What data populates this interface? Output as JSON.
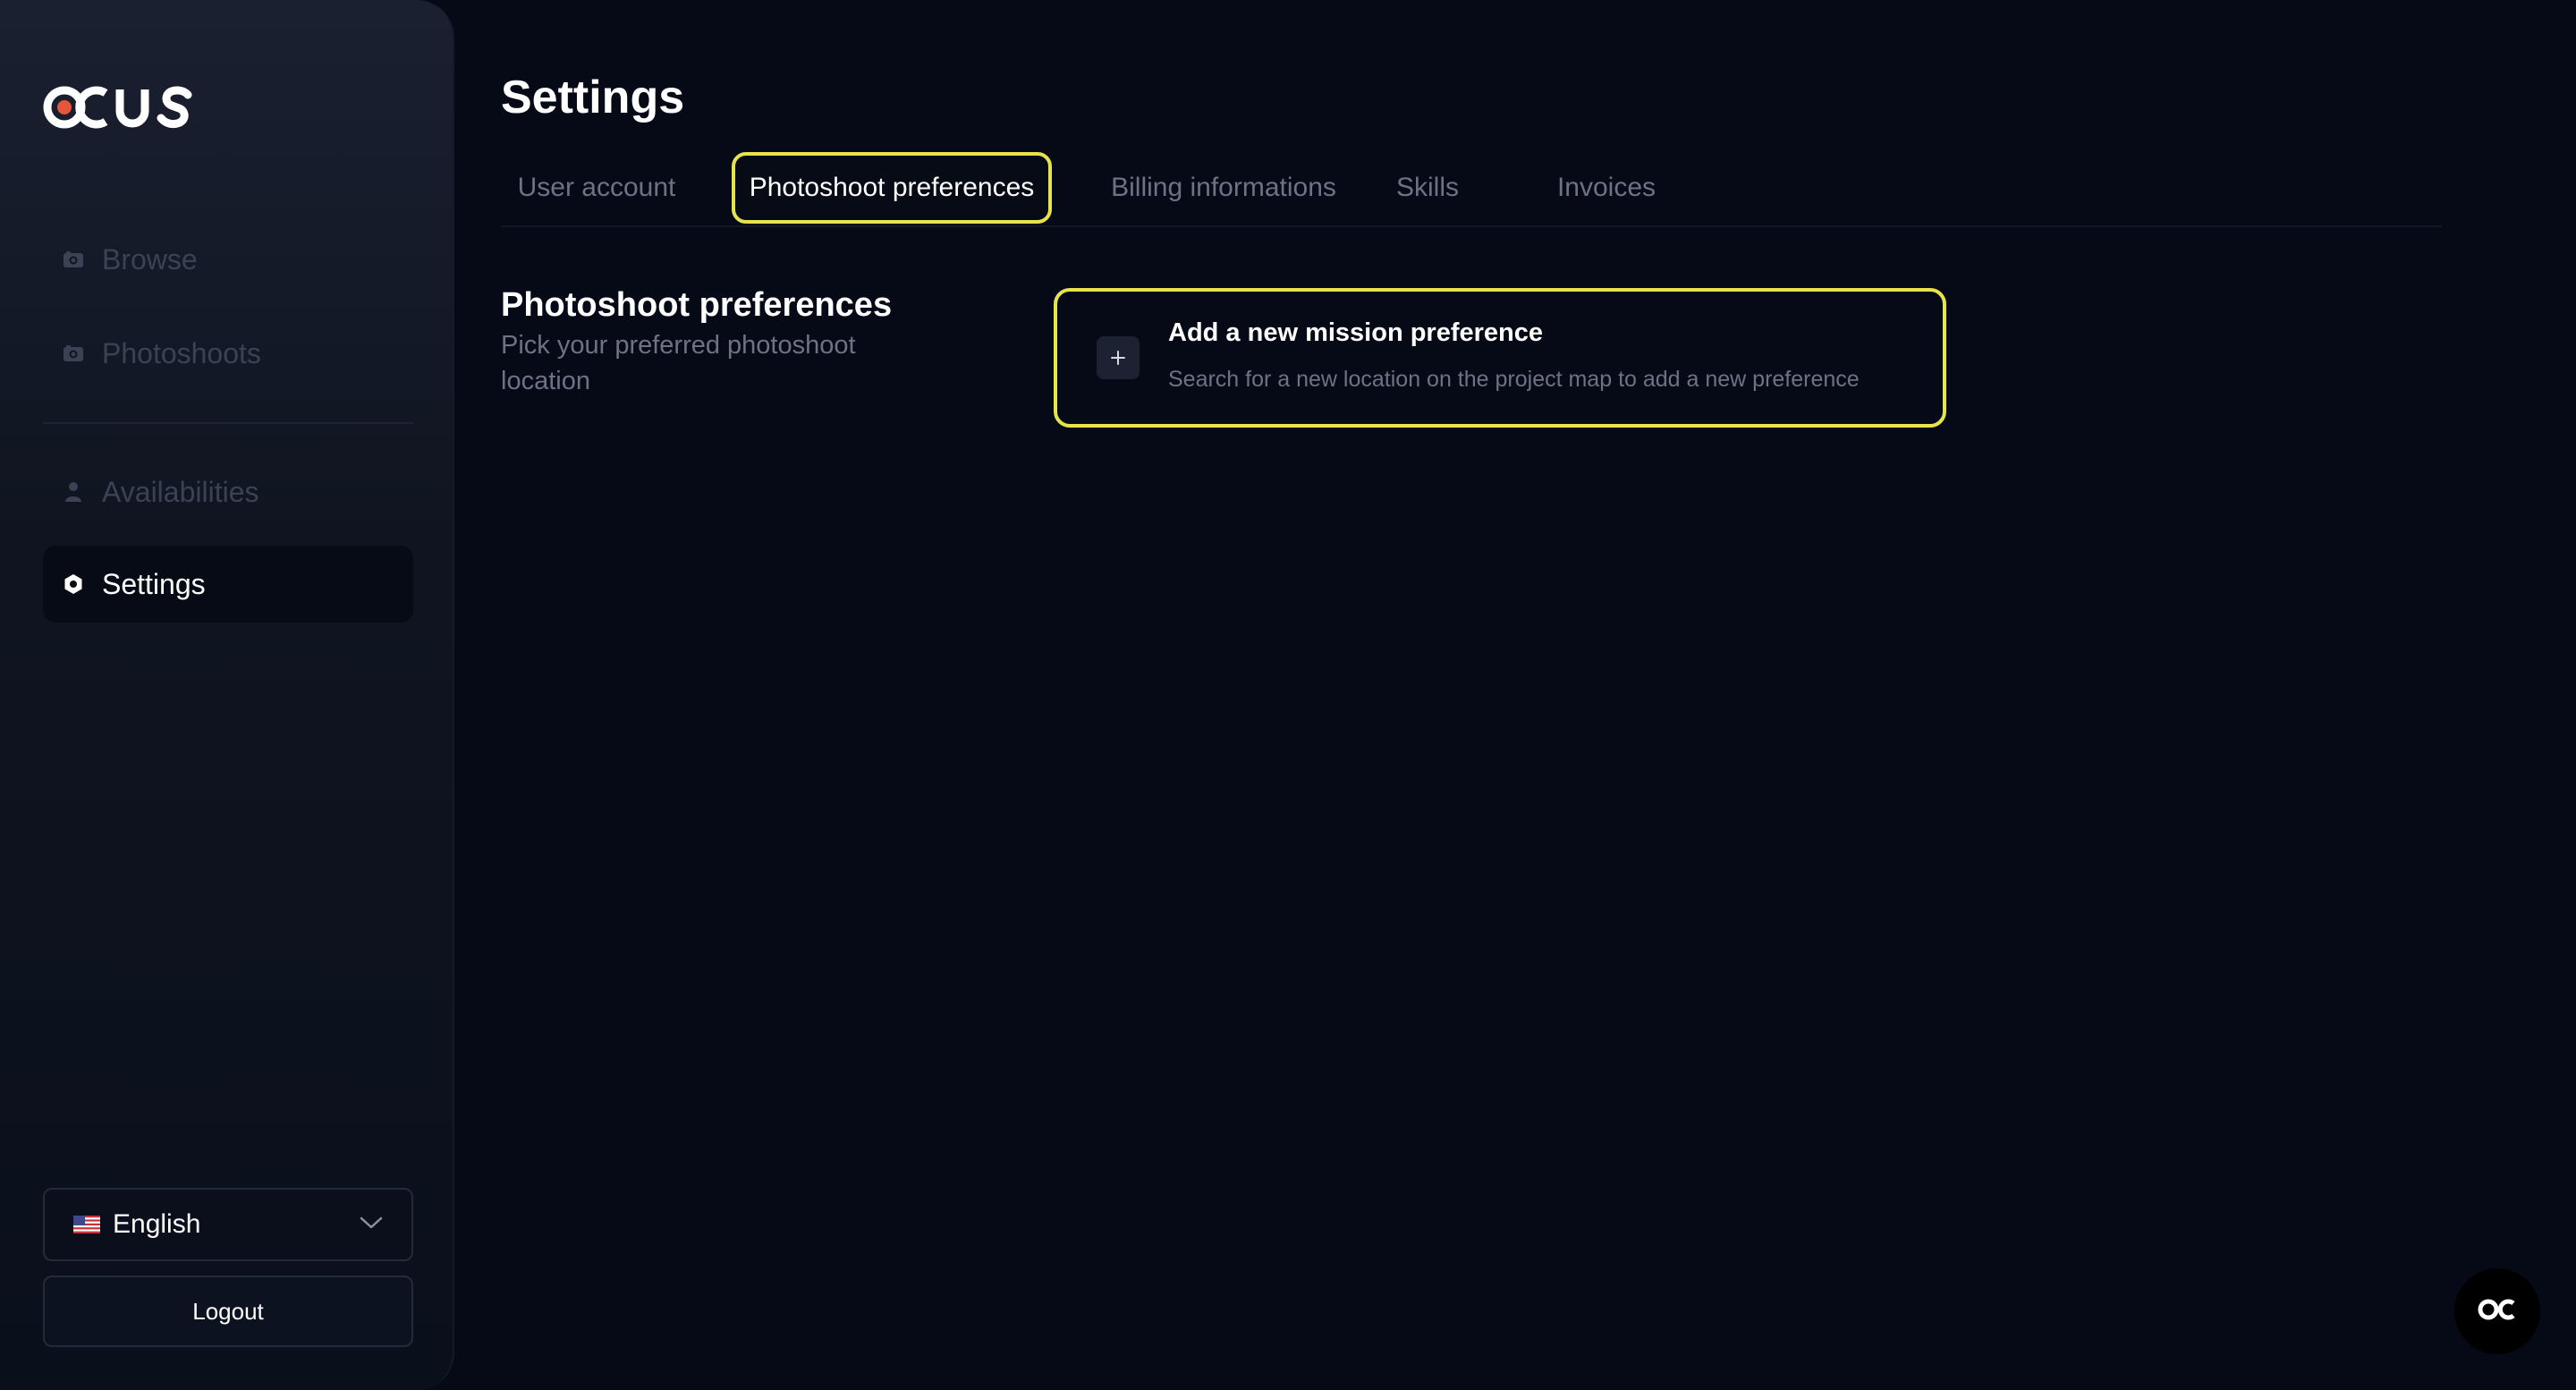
{
  "app": {
    "logo_text": "OCUS"
  },
  "sidebar": {
    "items": [
      {
        "label": "Browse",
        "icon": "camera-icon"
      },
      {
        "label": "Photoshoots",
        "icon": "camera-icon"
      },
      {
        "label": "Availabilities",
        "icon": "user-icon"
      },
      {
        "label": "Settings",
        "icon": "gear-icon",
        "active": true
      }
    ],
    "language": {
      "label": "English",
      "icon": "us-flag-icon"
    },
    "logout_label": "Logout"
  },
  "header": {
    "title": "Settings"
  },
  "tabs": [
    {
      "label": "User account"
    },
    {
      "label": "Photoshoot preferences",
      "active": true
    },
    {
      "label": "Billing informations"
    },
    {
      "label": "Skills"
    },
    {
      "label": "Invoices"
    }
  ],
  "section": {
    "title": "Photoshoot preferences",
    "description": "Pick your preferred photoshoot location"
  },
  "preference_card": {
    "title": "Add a new mission preference",
    "description": "Search for a new location on the project map to add a new preference",
    "icon": "plus-icon"
  },
  "chat": {
    "icon": "ocus-chat-icon"
  },
  "colors": {
    "background": "#050a16",
    "highlight": "#e6e44a",
    "muted_text": "#6b7385",
    "disabled_text": "#3a4254"
  }
}
